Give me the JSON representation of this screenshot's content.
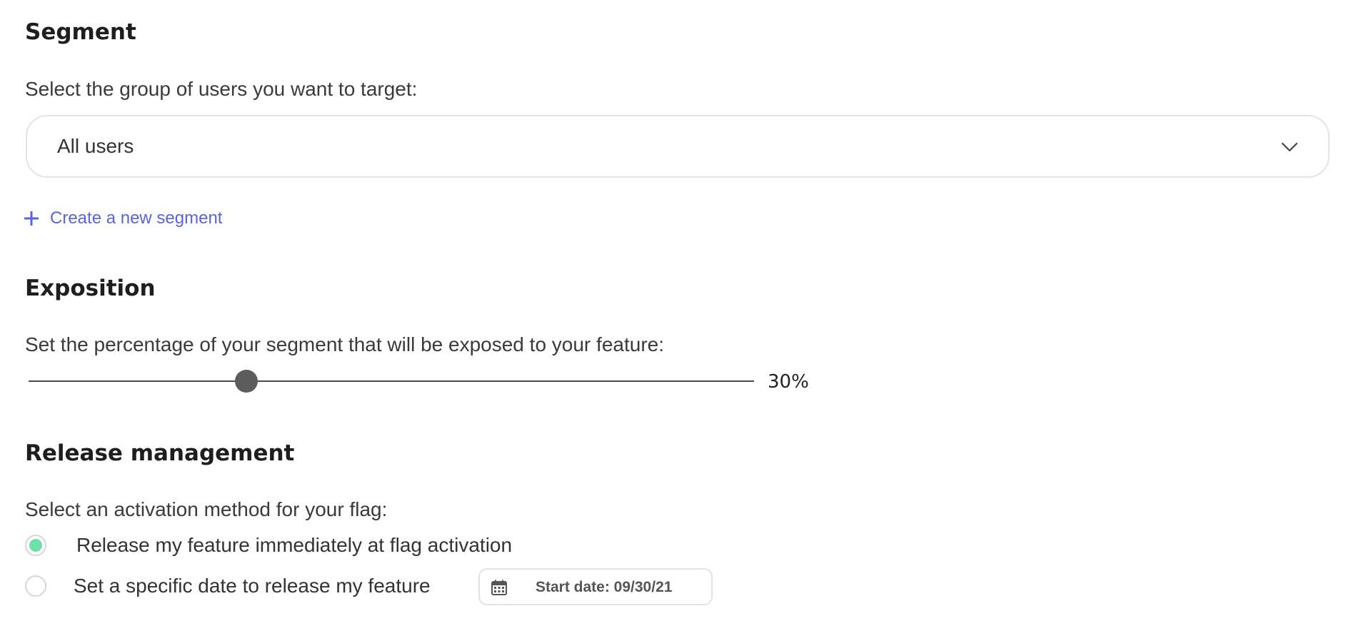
{
  "segment": {
    "title": "Segment",
    "description": "Select the group of users you want to target:",
    "select_value": "All users",
    "create_link": "Create a new segment"
  },
  "exposition": {
    "title": "Exposition",
    "description": "Set the percentage of your segment that will be exposed to your feature:",
    "percent": 30,
    "value_label": "30%"
  },
  "release": {
    "title": "Release management",
    "description": "Select an activation method for your flag:",
    "options": [
      {
        "label": "Release my feature immediately at flag activation",
        "checked": true
      },
      {
        "label": "Set a specific date to release my feature",
        "checked": false
      }
    ],
    "date_button": "Start date: 09/30/21"
  },
  "colors": {
    "accent": "#5a63e0",
    "radio_checked": "#6fe0a8",
    "slider_thumb": "#5c5c5c"
  },
  "icons": [
    "chevron-down-icon",
    "plus-icon",
    "calendar-icon"
  ]
}
